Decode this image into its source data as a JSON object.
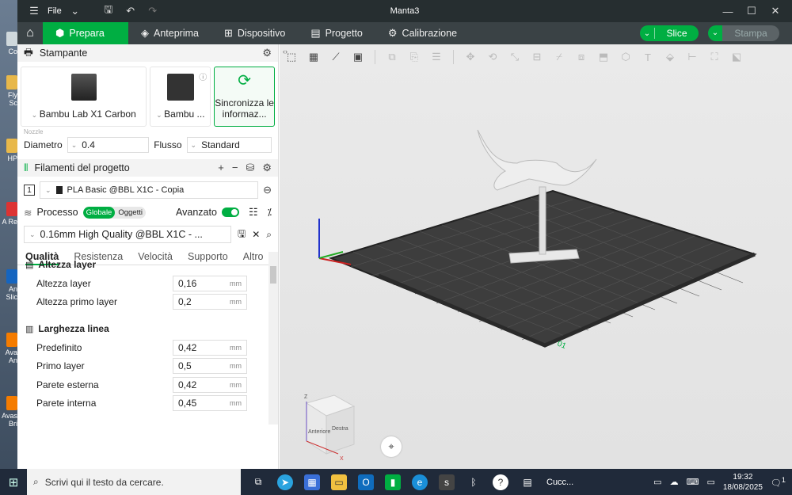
{
  "window": {
    "title": "Manta3",
    "file_menu": "File"
  },
  "tabs": [
    {
      "label": "Prepara",
      "icon": "cube-icon"
    },
    {
      "label": "Anteprima",
      "icon": "layers-icon"
    },
    {
      "label": "Dispositivo",
      "icon": "device-icon"
    },
    {
      "label": "Progetto",
      "icon": "project-icon"
    },
    {
      "label": "Calibrazione",
      "icon": "calibration-icon"
    }
  ],
  "actions": {
    "slice": "Slice",
    "print": "Stampa"
  },
  "printer": {
    "section_title": "Stampante",
    "cards": [
      {
        "name": "Bambu Lab X1 Carbon"
      },
      {
        "name": "Bambu ..."
      },
      {
        "name": "Sincronizza le informaz..."
      }
    ],
    "nozzle_legend": "Nozzle",
    "diameter_label": "Diametro",
    "diameter_value": "0.4",
    "flow_label": "Flusso",
    "flow_value": "Standard"
  },
  "filaments": {
    "section_title": "Filamenti del progetto",
    "items": [
      {
        "index": "1",
        "name": "PLA Basic @BBL X1C - Copia",
        "color": "#222222"
      }
    ]
  },
  "process": {
    "section_title": "Processo",
    "mode_global": "Globale",
    "mode_objects": "Oggetti",
    "advanced_label": "Avanzato",
    "preset": "0.16mm High Quality @BBL X1C - ...",
    "tabs": [
      "Qualità",
      "Resistenza",
      "Velocità",
      "Supporto",
      "Altro"
    ],
    "groups": [
      {
        "title": "Altezza layer",
        "rows": [
          {
            "label": "Altezza layer",
            "value": "0,16",
            "unit": "mm"
          },
          {
            "label": "Altezza primo layer",
            "value": "0,2",
            "unit": "mm"
          }
        ]
      },
      {
        "title": "Larghezza linea",
        "rows": [
          {
            "label": "Predefinito",
            "value": "0,42",
            "unit": "mm"
          },
          {
            "label": "Primo layer",
            "value": "0,5",
            "unit": "mm"
          },
          {
            "label": "Parete esterna",
            "value": "0,42",
            "unit": "mm"
          },
          {
            "label": "Parete interna",
            "value": "0,45",
            "unit": "mm"
          }
        ]
      }
    ]
  },
  "viewport": {
    "navcube": {
      "front": "Anteriore",
      "right": "Destra",
      "x_label": "X",
      "z_label": "Z"
    },
    "plate_label": "01"
  },
  "taskbar": {
    "search_placeholder": "Scrivi qui il testo da cercare.",
    "app_label": "Cucc...",
    "time": "19:32",
    "date": "18/08/2025",
    "notifications": "1"
  }
}
